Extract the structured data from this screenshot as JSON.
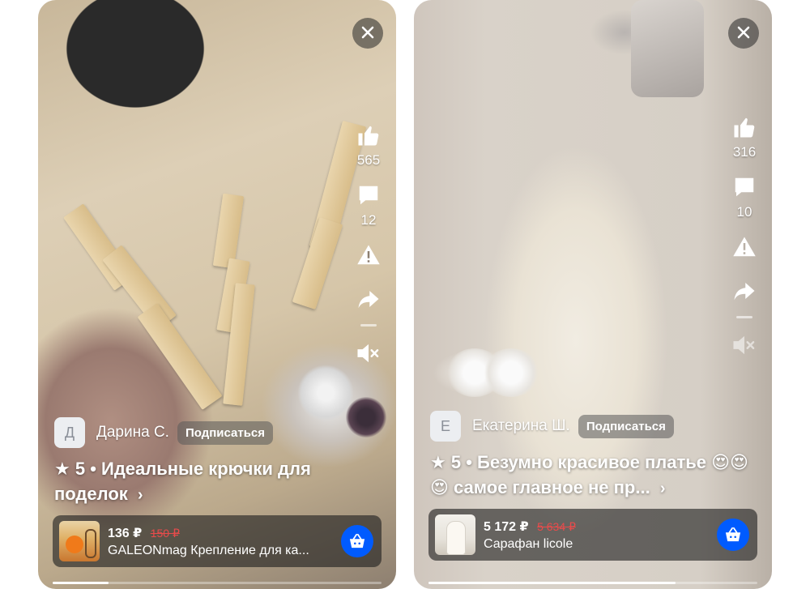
{
  "colors": {
    "accent": "#005bff",
    "old_price": "#e94b4b"
  },
  "cards": [
    {
      "author_initial": "Д",
      "author_name": "Дарина С.",
      "subscribe_label": "Подписаться",
      "rating_star": "★",
      "title": "5 • Идеальные крючки для поделок",
      "title_chevron": "›",
      "likes": "565",
      "comments": "12",
      "price": "136 ₽",
      "old_price": "150 ₽",
      "product_name": "GALEONmag Крепление для ка...",
      "close_icon": "close-icon",
      "progress": 0.17
    },
    {
      "author_initial": "Е",
      "author_name": "Екатерина Ш.",
      "subscribe_label": "Подписаться",
      "rating_star": "★",
      "title": "5 • Безумно красивое платье 😍😍😍 самое главное не пр...",
      "title_chevron": "›",
      "likes": "316",
      "comments": "10",
      "price": "5 172 ₽",
      "old_price": "5 634 ₽",
      "product_name": "Сарафан licole",
      "close_icon": "close-icon",
      "progress": 0.75
    }
  ]
}
